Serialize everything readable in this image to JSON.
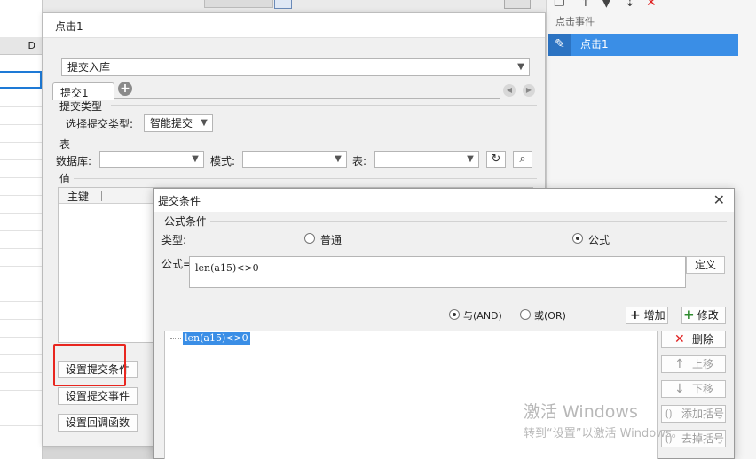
{
  "spreadsheet": {
    "column_label": "D"
  },
  "right_panel": {
    "header": "点击事件",
    "events": [
      {
        "label": "点击1"
      }
    ]
  },
  "main_dialog": {
    "title": "点击1",
    "action_select": {
      "value": "提交入库"
    },
    "tabs": [
      {
        "label": "提交1"
      }
    ],
    "submit_type_section": "提交类型",
    "submit_type_label": "选择提交类型:",
    "submit_type_value": "智能提交",
    "table_section": "表",
    "database_label": "数据库:",
    "mode_label": "模式:",
    "table_label": "表:",
    "value_section": "值",
    "grid_header_primary_key": "主键",
    "buttons": {
      "set_condition": "设置提交条件",
      "set_event": "设置提交事件",
      "set_callback": "设置回调函数"
    }
  },
  "condition_dialog": {
    "title": "提交条件",
    "formula_section": "公式条件",
    "type_label": "类型:",
    "type_options": {
      "normal": "普通",
      "formula": "公式"
    },
    "selected_type": "formula",
    "formula_label": "公式=",
    "formula_value": "len(a15)<>0",
    "define_button": "定义",
    "logic_options": {
      "and": "与(AND)",
      "or": "或(OR)"
    },
    "selected_logic": "and",
    "add_button": "增加",
    "edit_button": "修改",
    "tree_items": [
      "len(a15)<>0"
    ],
    "side_buttons": {
      "delete": "删除",
      "move_up": "上移",
      "move_down": "下移",
      "add_bracket": "添加括号",
      "remove_bracket": "去掉括号"
    }
  },
  "watermark": {
    "line1": "激活 Windows",
    "line2": "转到“设置”以激活 Windows。"
  },
  "colors": {
    "accent": "#3a8ee6",
    "highlight_box": "#e8261f",
    "delete_icon": "#e02020",
    "add_icon": "#1f1f1f",
    "edit_icon": "#2e8b2e"
  }
}
